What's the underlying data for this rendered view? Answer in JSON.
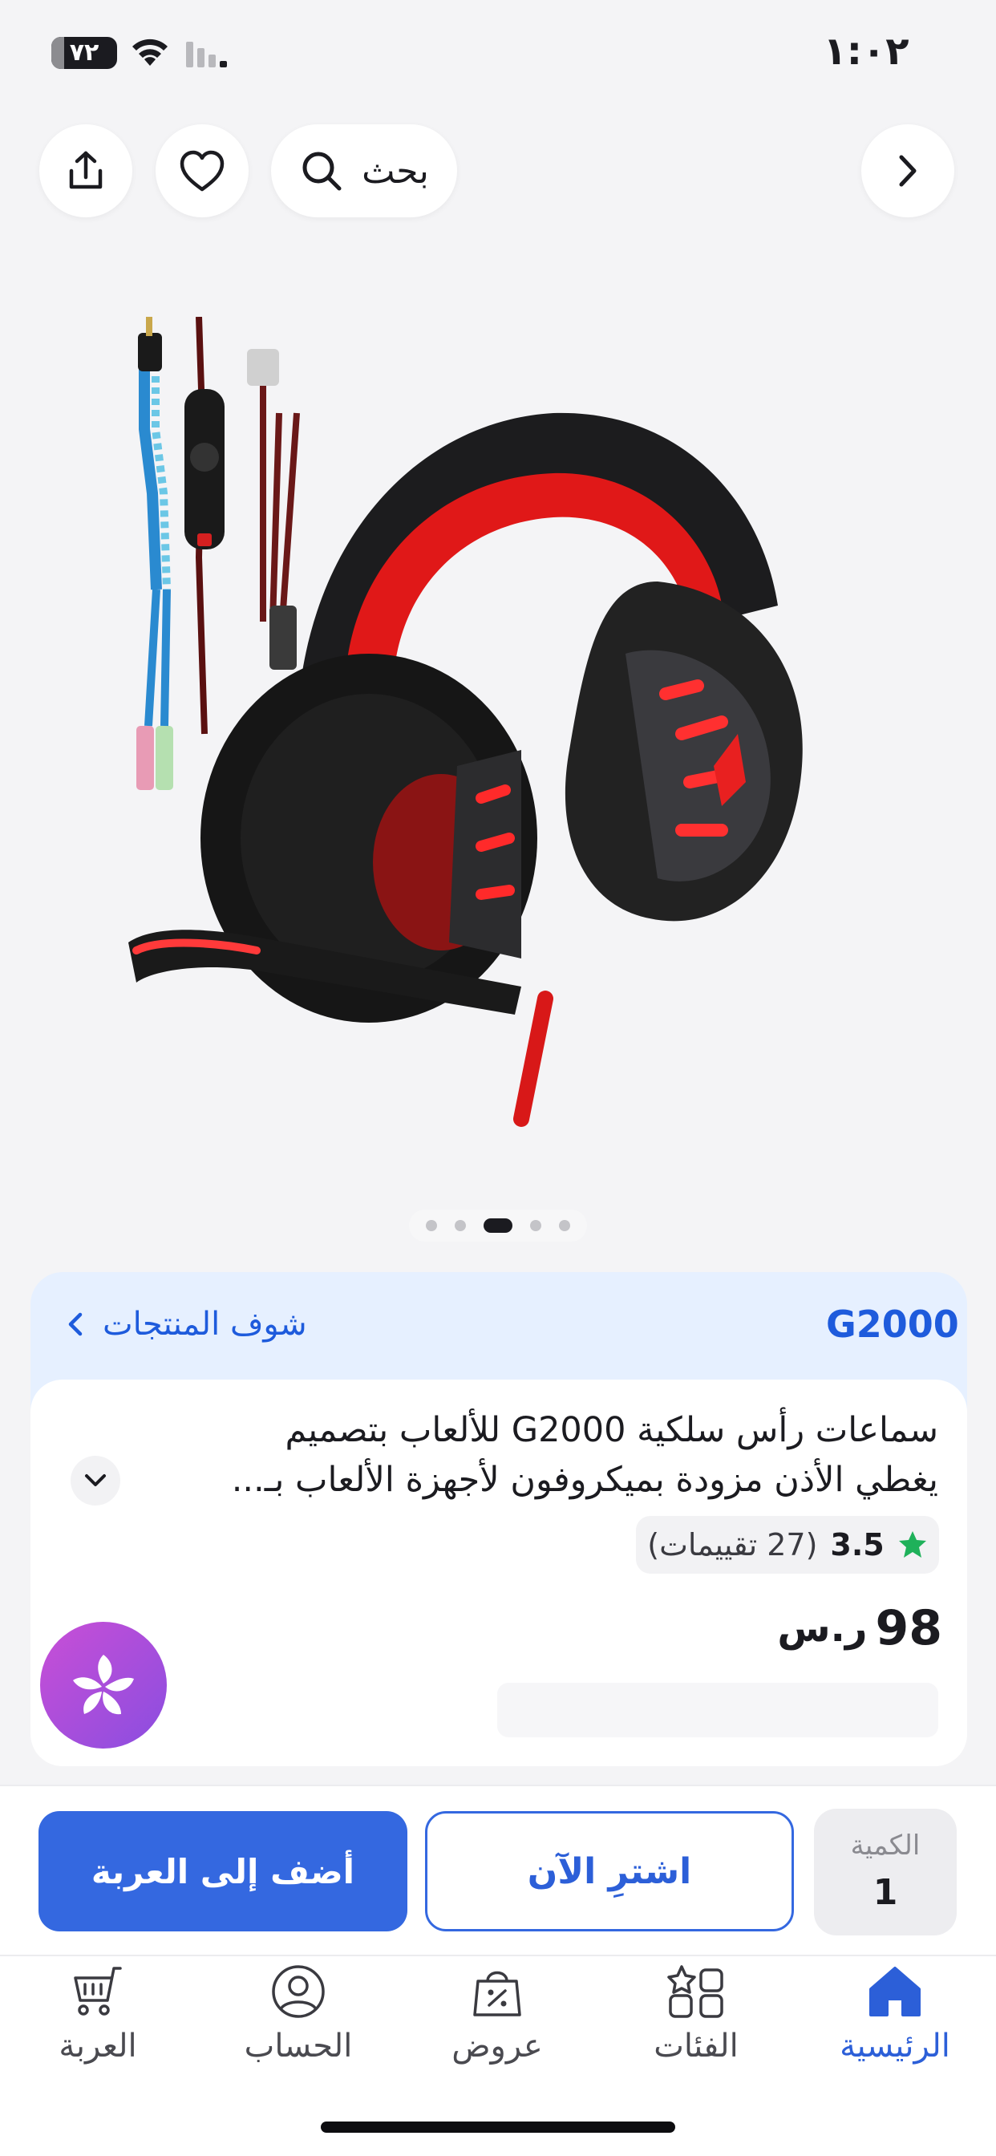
{
  "status_bar": {
    "time": "١:٠٢",
    "battery": "٧٢"
  },
  "top_actions": {
    "search_label": "بحث"
  },
  "gallery": {
    "image_description": "gaming-headset-red-black",
    "page_count": 5,
    "active_page": 3
  },
  "brand_banner": {
    "brand": "G2000",
    "see_products_label": "شوف المنتجات"
  },
  "product": {
    "title_line_1": "سماعات رأس سلكية G2000 للألعاب بتصميم",
    "title_line_2": "يغطي الأذن مزودة بميكروفون لأجهزة الألعاب بـ...",
    "rating": "3.5",
    "rating_count": "(27 تقييمات)",
    "price": "98",
    "currency_symbol": "ر.س",
    "rating_star_color": "#1fb15a"
  },
  "purchase_bar": {
    "quantity_label": "الكمية",
    "quantity_value": "1",
    "buy_now_label": "اشترِ الآن",
    "add_to_cart_label": "أضف إلى العربة"
  },
  "tab_bar": {
    "tabs": [
      {
        "label": "الرئيسية",
        "icon": "home-icon",
        "active": true
      },
      {
        "label": "الفئات",
        "icon": "categories-icon",
        "active": false
      },
      {
        "label": "عروض",
        "icon": "offers-bag-icon",
        "active": false
      },
      {
        "label": "الحساب",
        "icon": "account-icon",
        "active": false
      },
      {
        "label": "العربة",
        "icon": "cart-icon",
        "active": false
      }
    ]
  },
  "colors": {
    "accent": "#3468e0",
    "brand_text": "#1e5bdc",
    "banner_bg": "#e6f0ff"
  }
}
